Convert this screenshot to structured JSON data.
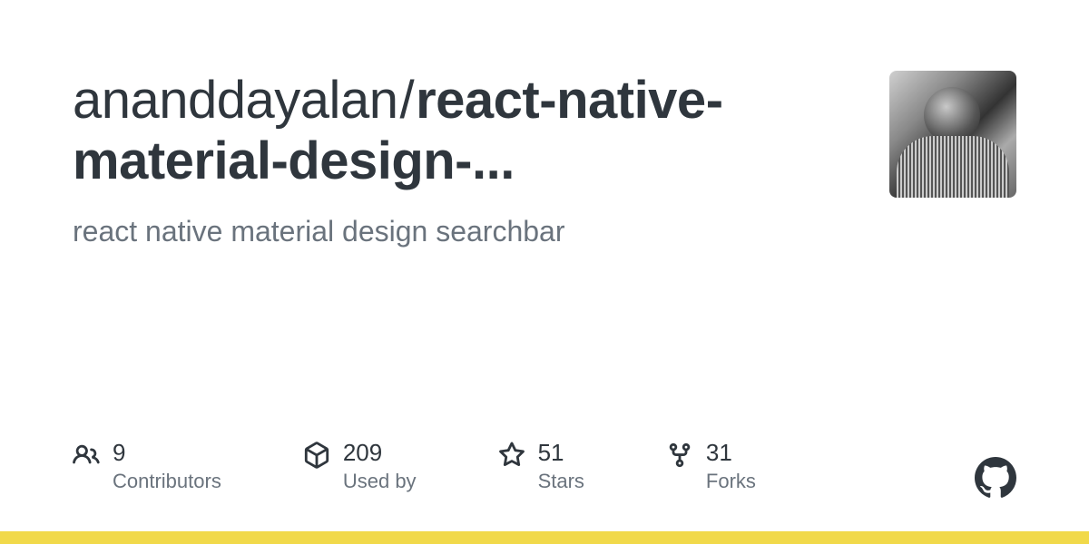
{
  "repo": {
    "owner": "ananddayalan",
    "name_truncated": "react-native-material-design-...",
    "description": "react native material design searchbar"
  },
  "stats": [
    {
      "icon": "people-icon",
      "value": "9",
      "label": "Contributors"
    },
    {
      "icon": "package-icon",
      "value": "209",
      "label": "Used by"
    },
    {
      "icon": "star-icon",
      "value": "51",
      "label": "Stars"
    },
    {
      "icon": "fork-icon",
      "value": "31",
      "label": "Forks"
    }
  ],
  "colors": {
    "accent_bar": "#f1d94a",
    "text_primary": "#2f363d",
    "text_secondary": "#6a737d"
  }
}
